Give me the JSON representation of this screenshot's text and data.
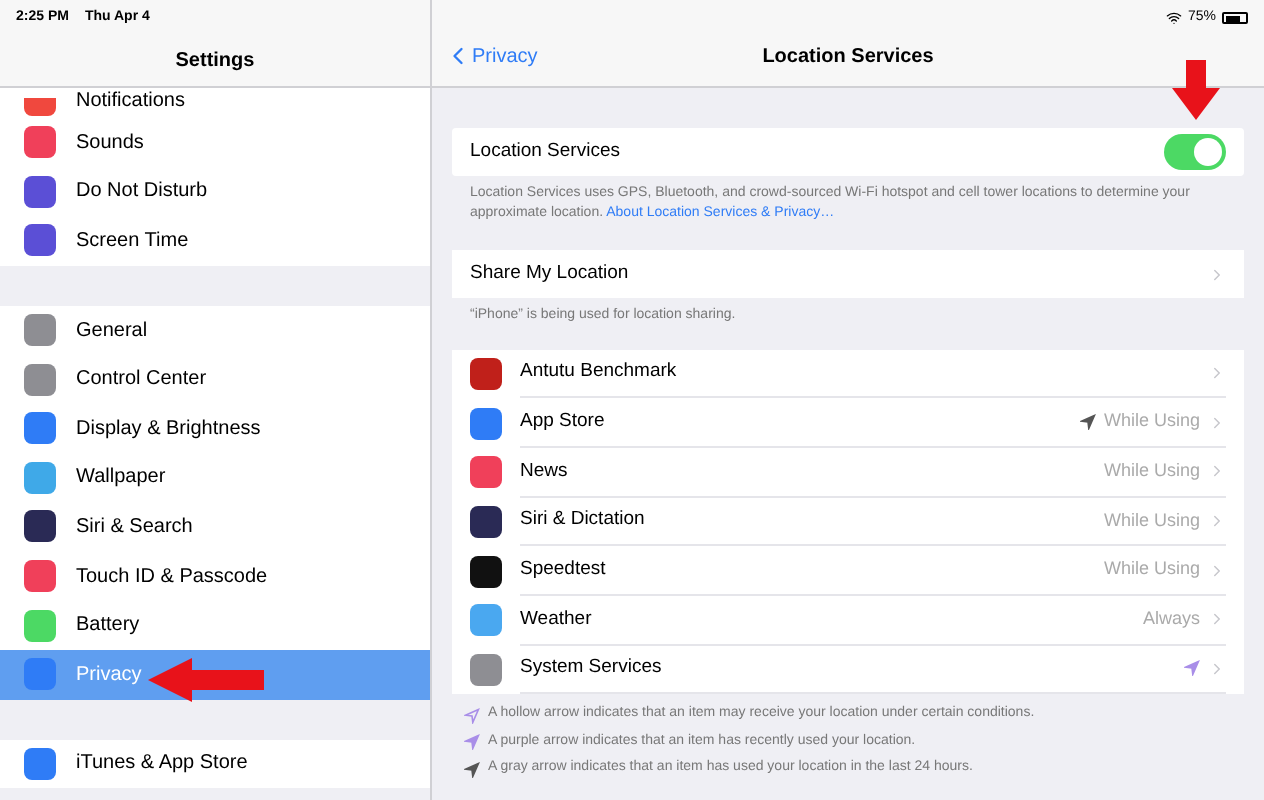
{
  "status_bar": {
    "time": "2:25 PM",
    "date": "Thu Apr 4",
    "battery_text": "75%"
  },
  "sidebar": {
    "title": "Settings",
    "groups": [
      {
        "items": [
          {
            "label": "Notifications",
            "color": "#f0483e",
            "selected": false
          },
          {
            "label": "Sounds",
            "color": "#f0405a",
            "selected": false
          },
          {
            "label": "Do Not Disturb",
            "color": "#5b4fd6",
            "selected": false
          },
          {
            "label": "Screen Time",
            "color": "#5b4fd6",
            "selected": false
          }
        ]
      },
      {
        "items": [
          {
            "label": "General",
            "color": "#8e8e93",
            "selected": false
          },
          {
            "label": "Control Center",
            "color": "#8e8e93",
            "selected": false
          },
          {
            "label": "Display & Brightness",
            "color": "#2f7cf6",
            "selected": false
          },
          {
            "label": "Wallpaper",
            "color": "#3fa9e8",
            "selected": false
          },
          {
            "label": "Siri & Search",
            "color": "#2a2a55",
            "selected": false
          },
          {
            "label": "Touch ID & Passcode",
            "color": "#f0405a",
            "selected": false
          },
          {
            "label": "Battery",
            "color": "#4cd964",
            "selected": false
          },
          {
            "label": "Privacy",
            "color": "#2f7cf6",
            "selected": true
          }
        ]
      },
      {
        "items": [
          {
            "label": "iTunes & App Store",
            "color": "#2f7cf6",
            "selected": false
          }
        ]
      }
    ]
  },
  "detail": {
    "back": "Privacy",
    "title": "Location Services",
    "main_toggle": {
      "label": "Location Services",
      "on": true
    },
    "description": "Location Services uses GPS, Bluetooth, and crowd-sourced Wi-Fi hotspot and cell tower locations to determine your approximate location.",
    "link": "About Location Services & Privacy…",
    "share": {
      "label": "Share My Location",
      "note": "“iPhone” is being used for location sharing."
    },
    "apps": [
      {
        "kind": "plain",
        "name": "Antutu Benchmark",
        "color": "#c0201a"
      },
      {
        "kind": "gray",
        "name": "App Store",
        "color": "#2f7cf6",
        "value": "While Using"
      },
      {
        "kind": "plain",
        "name": "News",
        "color": "#f0405a",
        "value": "While Using"
      },
      {
        "kind": "plain",
        "name": "Siri & Dictation",
        "color": "#2a2a55",
        "value": "While Using"
      },
      {
        "kind": "plain",
        "name": "Speedtest",
        "color": "#111111",
        "value": "While Using"
      },
      {
        "kind": "plain",
        "name": "Weather",
        "color": "#4aa8f0",
        "value": "Always"
      },
      {
        "kind": "purple",
        "name": "System Services",
        "color": "#8e8e93"
      }
    ],
    "legend": [
      {
        "kind": "hollow",
        "text": "A hollow arrow indicates that an item may receive your location under certain conditions."
      },
      {
        "kind": "purple",
        "text": "A purple arrow indicates that an item has recently used your location."
      },
      {
        "kind": "gray",
        "text": "A gray arrow indicates that an item has used your location in the last 24 hours."
      }
    ]
  }
}
